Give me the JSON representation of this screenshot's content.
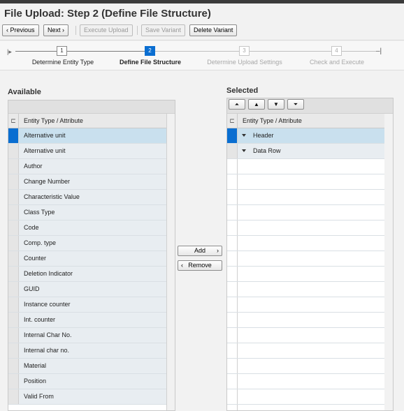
{
  "title": "File Upload: Step 2  (Define File Structure)",
  "toolbar": {
    "previous": "Previous",
    "next": "Next",
    "execute_upload": "Execute Upload",
    "save_variant": "Save Variant",
    "delete_variant": "Delete Variant"
  },
  "roadmap": {
    "steps": [
      {
        "number": "1",
        "label": "Determine Entity Type",
        "state": "done"
      },
      {
        "number": "2",
        "label": "Define File Structure",
        "state": "active"
      },
      {
        "number": "3",
        "label": "Determine Upload Settings",
        "state": "pending"
      },
      {
        "number": "4",
        "label": "Check and Execute",
        "state": "pending"
      }
    ]
  },
  "available": {
    "heading": "Available",
    "column_header": "Entity Type / Attribute",
    "rows": [
      "Alternative unit",
      "Alternative unit",
      "Author",
      "Change Number",
      "Characteristic Value",
      "Class Type",
      "Code",
      "Comp. type",
      "Counter",
      "Deletion Indicator",
      "GUID",
      "Instance counter",
      "Int. counter",
      "Internal Char No.",
      "Internal char no.",
      "Material",
      "Position",
      "Valid From"
    ]
  },
  "actions": {
    "add": "Add",
    "remove": "Remove"
  },
  "selected": {
    "heading": "Selected",
    "column_header": "Entity Type / Attribute",
    "rows": [
      "Header",
      "Data Row"
    ]
  },
  "colors": {
    "accent": "#0a6ed1",
    "row_highlight": "#c9e0ee",
    "row_bg": "#e8edf1"
  }
}
